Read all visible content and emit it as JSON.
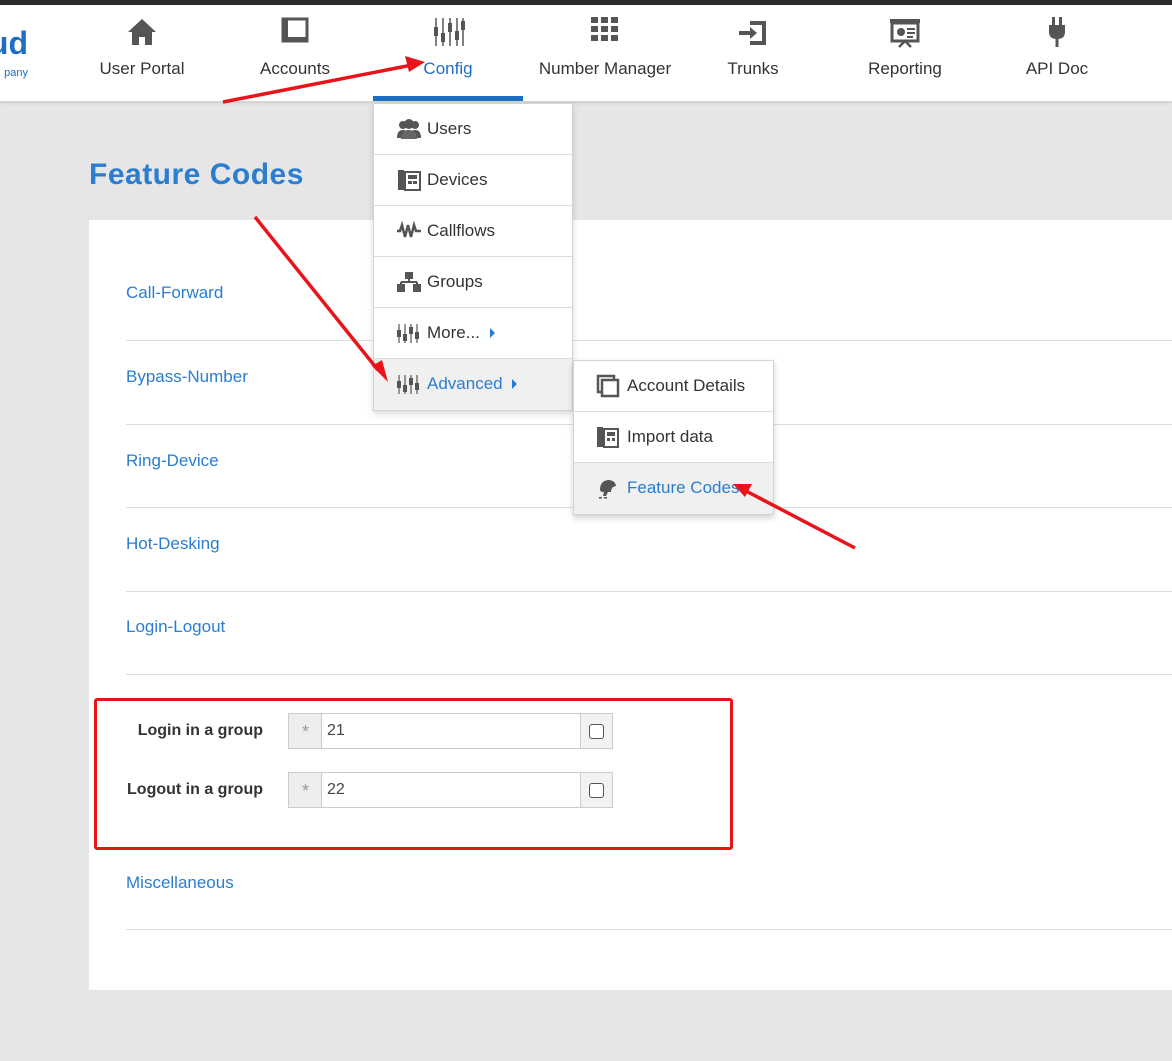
{
  "brand": {
    "name_fragment": "ud",
    "tagline_fragment": "pany",
    "color": "#1d6fc4"
  },
  "nav": {
    "items": [
      {
        "label": "User Portal",
        "icon": "house-icon"
      },
      {
        "label": "Accounts",
        "icon": "window-icon"
      },
      {
        "label": "Config",
        "icon": "equalizer-icon",
        "active": true
      },
      {
        "label": "Number Manager",
        "icon": "keypad-icon"
      },
      {
        "label": "Trunks",
        "icon": "login-arrow-icon"
      },
      {
        "label": "Reporting",
        "icon": "presentation-icon"
      },
      {
        "label": "API Doc",
        "icon": "plug-icon"
      }
    ]
  },
  "page": {
    "title": "Feature Codes"
  },
  "sections": [
    "Call-Forward",
    "Bypass-Number",
    "Ring-Device",
    "Hot-Desking",
    "Login-Logout",
    "Miscellaneous"
  ],
  "group_codes": [
    {
      "label": "Login in a group",
      "prefix": "*",
      "value": "21",
      "checked": false
    },
    {
      "label": "Logout in a group",
      "prefix": "*",
      "value": "22",
      "checked": false
    }
  ],
  "config_menu": {
    "items": [
      {
        "label": "Users",
        "icon": "users-icon"
      },
      {
        "label": "Devices",
        "icon": "phone-device-icon"
      },
      {
        "label": "Callflows",
        "icon": "waveform-icon"
      },
      {
        "label": "Groups",
        "icon": "hierarchy-icon"
      },
      {
        "label": "More...",
        "icon": "equalizer-icon"
      },
      {
        "label": "Advanced",
        "icon": "equalizer-icon",
        "highlighted": true
      }
    ]
  },
  "advanced_submenu": {
    "items": [
      {
        "label": "Account Details",
        "icon": "window-stack-icon"
      },
      {
        "label": "Import data",
        "icon": "phone-device-icon"
      },
      {
        "label": "Feature Codes",
        "icon": "bird-icon",
        "highlighted": true
      }
    ]
  },
  "colors": {
    "accent": "#2a7dd1",
    "annotation": "#e8141a"
  }
}
